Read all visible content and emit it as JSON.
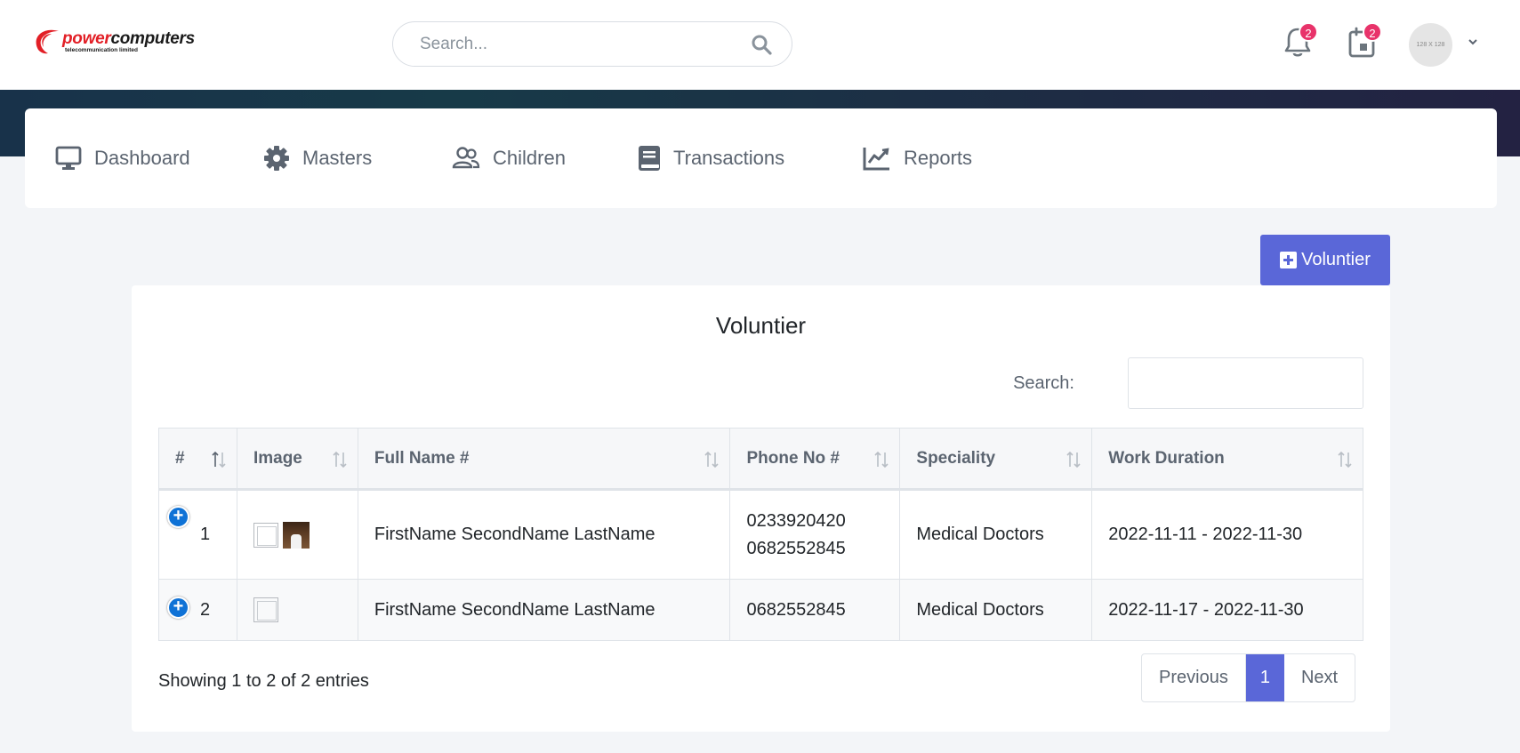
{
  "brand": {
    "name_part1": "power",
    "name_part2": "computers",
    "tagline": "telecommunication limited",
    "accent_color": "#e21f26"
  },
  "header": {
    "search_placeholder": "Search...",
    "notifications_count": "2",
    "calendar_count": "2",
    "avatar_text": "128 X 128"
  },
  "nav": {
    "items": [
      {
        "label": "Dashboard",
        "icon": "monitor-icon"
      },
      {
        "label": "Masters",
        "icon": "gear-icon"
      },
      {
        "label": "Children",
        "icon": "users-icon"
      },
      {
        "label": "Transactions",
        "icon": "book-icon"
      },
      {
        "label": "Reports",
        "icon": "chart-line-icon"
      }
    ]
  },
  "actions": {
    "add_label": "Voluntier",
    "accent_color": "#5a67d8"
  },
  "table": {
    "title": "Voluntier",
    "search_label": "Search:",
    "columns": [
      "#",
      "Image",
      "Full Name #",
      "Phone No #",
      "Speciality",
      "Work Duration"
    ],
    "rows": [
      {
        "id": "1",
        "full_name": "FirstName SecondName LastName",
        "phone1": "0233920420",
        "phone2": "0682552845",
        "speciality": "Medical Doctors",
        "work_duration": "2022-11-11 - 2022-11-30"
      },
      {
        "id": "2",
        "full_name": "FirstName SecondName LastName",
        "phone1": "0682552845",
        "speciality": "Medical Doctors",
        "work_duration": "2022-11-17 - 2022-11-30"
      }
    ],
    "info": "Showing 1 to 2 of 2 entries",
    "pager": {
      "previous": "Previous",
      "current": "1",
      "next": "Next"
    }
  }
}
